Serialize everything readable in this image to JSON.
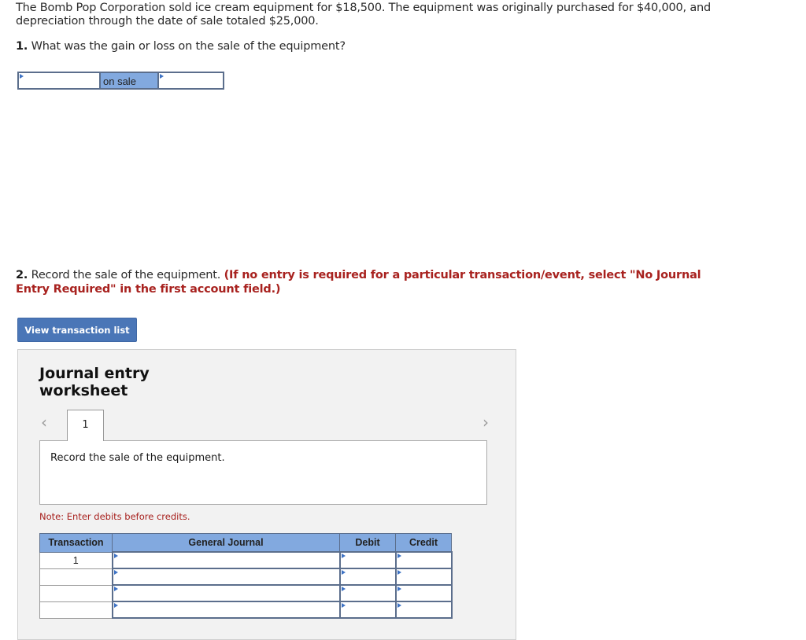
{
  "intro": {
    "line1": "The Bomb Pop Corporation sold ice cream equipment for $18,500. The equipment was originally purchased for $40,000, and",
    "line2": "depreciation through the date of sale totaled $25,000."
  },
  "q1": {
    "number": "1.",
    "text": " What was the gain or loss on the sale of the equipment?",
    "answer_row": {
      "gain_loss_select": "",
      "label": "on sale",
      "amount": ""
    }
  },
  "q2": {
    "number": "2.",
    "text": " Record the sale of the equipment. ",
    "instruction": "(If no entry is required for a particular transaction/event, select \"No Journal Entry Required\" in the first account field.)"
  },
  "view_transaction_button": "View transaction list",
  "worksheet": {
    "title": "Journal entry worksheet",
    "prev_icon": "chevron-left-icon",
    "next_icon": "chevron-right-icon",
    "tabs": [
      "1"
    ],
    "description": "Record the sale of the equipment.",
    "note": "Note: Enter debits before credits.",
    "table": {
      "headers": [
        "Transaction",
        "General Journal",
        "Debit",
        "Credit"
      ],
      "rows": [
        {
          "transaction": "1",
          "account": "",
          "debit": "",
          "credit": ""
        },
        {
          "transaction": "",
          "account": "",
          "debit": "",
          "credit": ""
        },
        {
          "transaction": "",
          "account": "",
          "debit": "",
          "credit": ""
        },
        {
          "transaction": "",
          "account": "",
          "debit": "",
          "credit": ""
        }
      ]
    }
  },
  "colors": {
    "header_blue": "#82a9df",
    "button_blue": "#4a76b7",
    "instruction_red": "#a8221f"
  }
}
